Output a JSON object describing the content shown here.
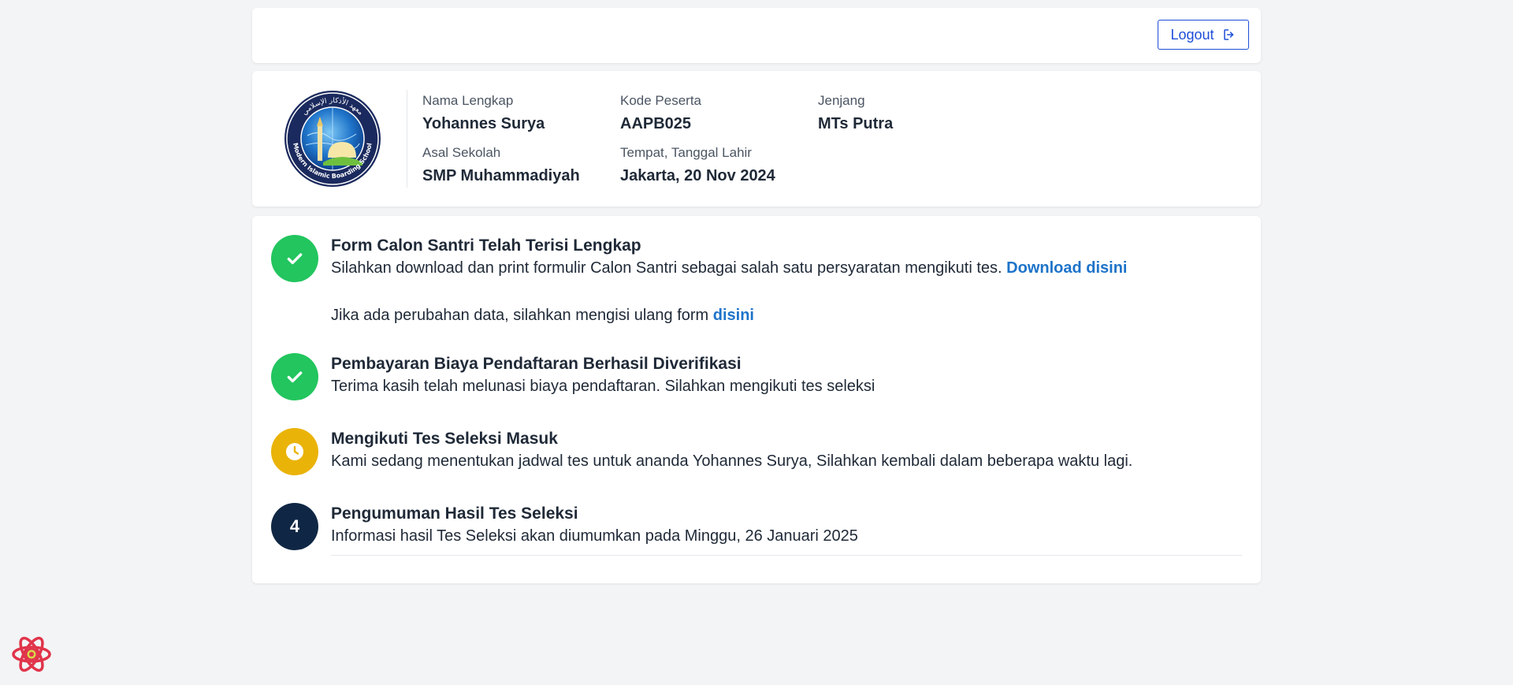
{
  "header": {
    "logout_label": "Logout"
  },
  "profile": {
    "logo_alt": "Modern Islamic Boarding School",
    "logo_top_text": "معهد الأذكار الإسلامي",
    "logo_bottom_text": "Modern Islamic Boarding School",
    "fields": [
      {
        "label": "Nama Lengkap",
        "value": "Yohannes Surya"
      },
      {
        "label": "Kode Peserta",
        "value": "AAPB025"
      },
      {
        "label": "Jenjang",
        "value": "MTs Putra"
      },
      {
        "label": "Asal Sekolah",
        "value": "SMP Muhammadiyah"
      },
      {
        "label": "Tempat, Tanggal Lahir",
        "value": "Jakarta, 20 Nov 2024"
      }
    ]
  },
  "steps": [
    {
      "status": "done",
      "title": "Form Calon Santri Telah Terisi Lengkap",
      "desc": "Silahkan download dan print formulir Calon Santri sebagai salah satu persyaratan mengikuti tes.",
      "link": "Download disini",
      "note": "Jika ada perubahan data, silahkan mengisi ulang form",
      "note_link": "disini"
    },
    {
      "status": "done",
      "title": "Pembayaran Biaya Pendaftaran Berhasil Diverifikasi",
      "desc": "Terima kasih telah melunasi biaya pendaftaran. Silahkan mengikuti tes seleksi"
    },
    {
      "status": "pending",
      "title": "Mengikuti Tes Seleksi Masuk",
      "desc": "Kami sedang menentukan jadwal tes untuk ananda Yohannes Surya, Silahkan kembali dalam beberapa waktu lagi."
    },
    {
      "status": "upcoming",
      "number": "4",
      "title": "Pengumuman Hasil Tes Seleksi",
      "desc": "Informasi hasil Tes Seleksi akan diumumkan pada Minggu, 26 Januari 2025"
    }
  ],
  "colors": {
    "done": "#22c55e",
    "pending": "#eab308",
    "upcoming": "#0f2744",
    "link": "#1d73c9",
    "accent": "#1d4ed8"
  }
}
